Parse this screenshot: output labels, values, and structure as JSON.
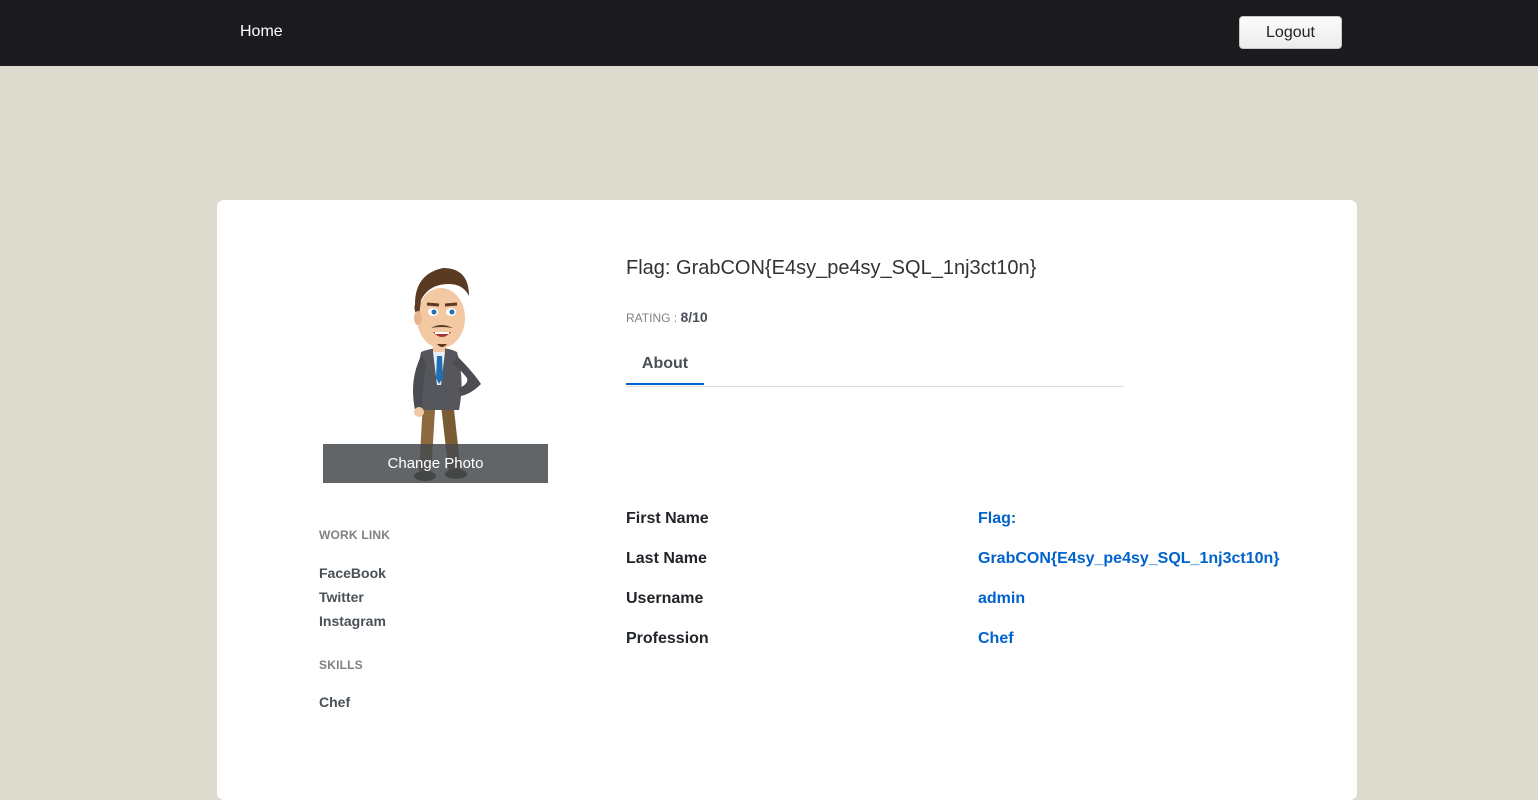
{
  "nav": {
    "home_label": "Home",
    "logout_label": "Logout"
  },
  "profile": {
    "title": "Flag: GrabCON{E4sy_pe4sy_SQL_1nj3ct10n}",
    "rating_label": "RATING : ",
    "rating_value": "8/10",
    "change_photo_label": "Change Photo",
    "tabs": [
      {
        "label": "About"
      }
    ]
  },
  "sidebar": {
    "work_link_heading": "WORK LINK",
    "links": [
      {
        "label": "FaceBook"
      },
      {
        "label": "Twitter"
      },
      {
        "label": "Instagram"
      }
    ],
    "skills_heading": "SKILLS",
    "skills": [
      {
        "label": "Chef"
      }
    ]
  },
  "about": {
    "fields": [
      {
        "label": "First Name",
        "value": "Flag:"
      },
      {
        "label": "Last Name",
        "value": "GrabCON{E4sy_pe4sy_SQL_1nj3ct10n}"
      },
      {
        "label": "Username",
        "value": "admin"
      },
      {
        "label": "Profession",
        "value": "Chef"
      }
    ]
  },
  "colors": {
    "navbar_bg": "#1b1a1f",
    "page_bg": "#dcdbce",
    "accent": "#0062cc"
  }
}
